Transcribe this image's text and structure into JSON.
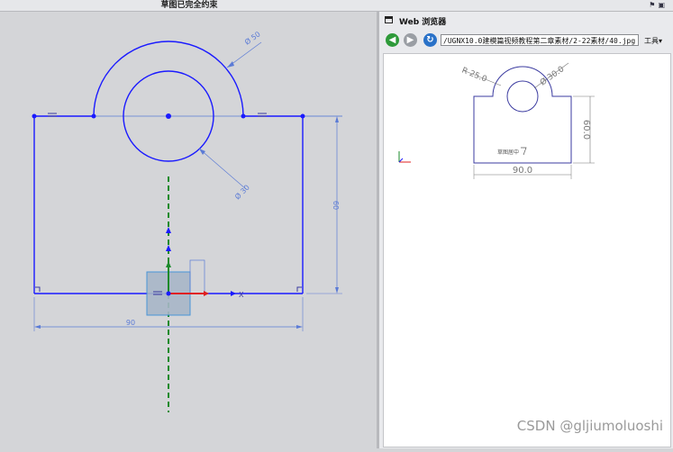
{
  "status_bar": {
    "message": "草图已完全约束",
    "icons": [
      "flag-icon",
      "window-icon"
    ]
  },
  "sketch": {
    "dimensions": {
      "top_circle_diameter": "Ø 50",
      "inner_circle_diameter": "Ø 30",
      "height": "60",
      "width": "90"
    },
    "axes": {
      "x_label": "X"
    },
    "colors": {
      "geometry": "#1a1aff",
      "dimension": "#5b7bd6",
      "x_axis": "#e02020",
      "y_axis": "#1a8a2a"
    }
  },
  "browser": {
    "title": "Web 浏览器",
    "url": "/UGNX10.0建模篇视频教程第二章素材/2-22素材/40.jpg",
    "tools_label": "工具",
    "nav_icons": [
      "back-icon",
      "forward-icon",
      "refresh-icon"
    ],
    "drawing": {
      "radius_label": "R 25.0",
      "diameter_label": "Ø 30.0",
      "height_label": "60.0",
      "width_label": "90.0",
      "note": "草图居中"
    }
  },
  "watermark": "CSDN @gljiumoluoshi"
}
